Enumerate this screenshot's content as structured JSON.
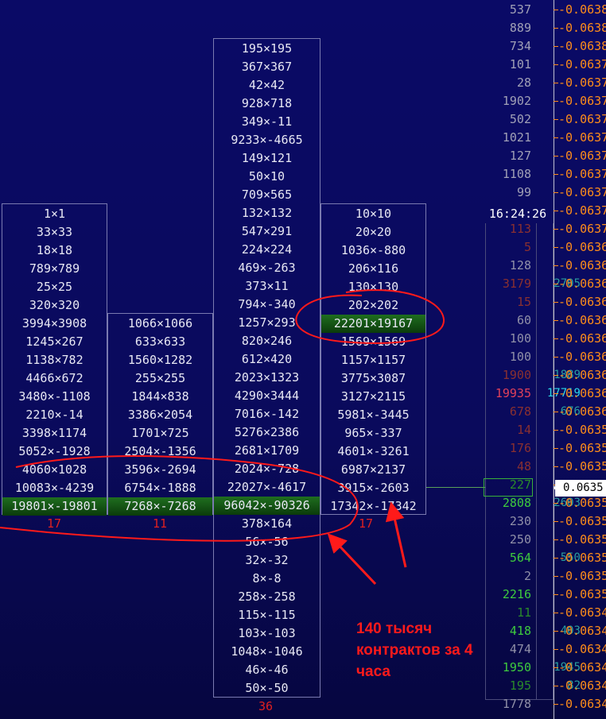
{
  "columns": [
    {
      "cells": [
        "1×1",
        "33×33",
        "18×18",
        "789×789",
        "25×25",
        "320×320",
        "3994×3908",
        "1245×267",
        "1138×782",
        "4466×672",
        "3480×-1108",
        "2210×-14",
        "3398×1174",
        "5052×-1928",
        "4060×1028",
        "10083×-4239",
        "19801×-19801"
      ],
      "count": "17"
    },
    {
      "cells": [
        "1066×1066",
        "633×633",
        "1560×1282",
        "255×255",
        "1844×838",
        "3386×2054",
        "1701×725",
        "2504×-1356",
        "3596×-2694",
        "6754×-1888",
        "7268×-7268"
      ],
      "count": "11"
    },
    {
      "cells": [
        "195×195",
        "367×367",
        "42×42",
        "928×718",
        "349×-11",
        "9233×-4665",
        "149×121",
        "50×10",
        "709×565",
        "132×132",
        "547×291",
        "224×224",
        "469×-263",
        "373×11",
        "794×-340",
        "1257×293",
        "820×246",
        "612×420",
        "2023×1323",
        "4290×3444",
        "7016×-142",
        "5276×2386",
        "2681×1709",
        "2024×-728",
        "22027×-4617",
        "96042×-90326",
        "378×164",
        "56×-56",
        "32×-32",
        "8×-8",
        "258×-258",
        "115×-115",
        "103×-103",
        "1048×-1046",
        "46×-46",
        "50×-50"
      ],
      "count": "36"
    },
    {
      "cells": [
        "10×10",
        "20×20",
        "1036×-880",
        "206×116",
        "130×130",
        "202×202",
        "22201×19167",
        "1569×1569",
        "1157×1157",
        "3775×3087",
        "3127×2115",
        "5981×-3445",
        "965×-337",
        "4601×-3261",
        "6987×2137",
        "3915×-2603",
        "17342×-17342"
      ],
      "count": "17"
    }
  ],
  "volume_column": [
    "537",
    "889",
    "734",
    "101",
    "28",
    "1902",
    "502",
    "1021",
    "127",
    "1108",
    "99",
    "",
    "113",
    "5",
    "128",
    "3179",
    "15",
    "60",
    "100",
    "100",
    "1900",
    "19935",
    "678",
    "14",
    "176",
    "48",
    "227",
    "2808",
    "230",
    "250",
    "564",
    "2",
    "2216",
    "11",
    "418",
    "474",
    "1950",
    "195",
    "1778"
  ],
  "volume_colors": {
    "top": "#a0a0b6",
    "dim_red": "#8a3030",
    "red": "#e0405a",
    "gray": "#9090a8",
    "white": "#ffffff",
    "green": "#3ecb3e",
    "dim_green": "#2a8a2a"
  },
  "overlay_values": [
    {
      "row": 15,
      "text": "2705",
      "color": "#2aa0a0"
    },
    {
      "row": 20,
      "text": "1889",
      "color": "#2aa0a0"
    },
    {
      "row": 21,
      "text": "17719",
      "color": "#2ad8e8"
    },
    {
      "row": 22,
      "text": "676",
      "color": "#2aa0a0"
    },
    {
      "row": 27,
      "text": "2603",
      "color": "#2aa0a0"
    },
    {
      "row": 30,
      "text": "550",
      "color": "#2aa0a0"
    },
    {
      "row": 34,
      "text": "403",
      "color": "#2aa0a0"
    },
    {
      "row": 36,
      "text": "1945",
      "color": "#2aa0a0"
    },
    {
      "row": 37,
      "text": "82",
      "color": "#2aa0a0"
    }
  ],
  "prices": [
    "-0.0638",
    "-0.0638",
    "-0.0638",
    "-0.0637",
    "-0.0637",
    "-0.0637",
    "-0.0637",
    "-0.0637",
    "-0.0637",
    "-0.0637",
    "-0.0637",
    "-0.0637",
    "-0.0637",
    "-0.0636",
    "-0.0636",
    "-0.0636",
    "-0.0636",
    "-0.0636",
    "-0.0636",
    "-0.0636",
    "-0.0636",
    "-0.0636",
    "-0.0636",
    "-0.0635",
    "-0.0635",
    "-0.0635",
    "-0.0635",
    "-0.0635",
    "-0.0635",
    "-0.0635",
    "-0.0635",
    "-0.0635",
    "-0.0635",
    "-0.0634",
    "-0.0634",
    "-0.0634",
    "-0.0634",
    "-0.0634",
    "-0.0634"
  ],
  "time_label": "16:24:26",
  "current_price": "0.0635",
  "annotation_text": "140 тысяч контрактов за 4 часа",
  "highlight_color": "#1f6e1f",
  "annotation_color": "#ff1a1a",
  "price_color": "#ff8d1a"
}
